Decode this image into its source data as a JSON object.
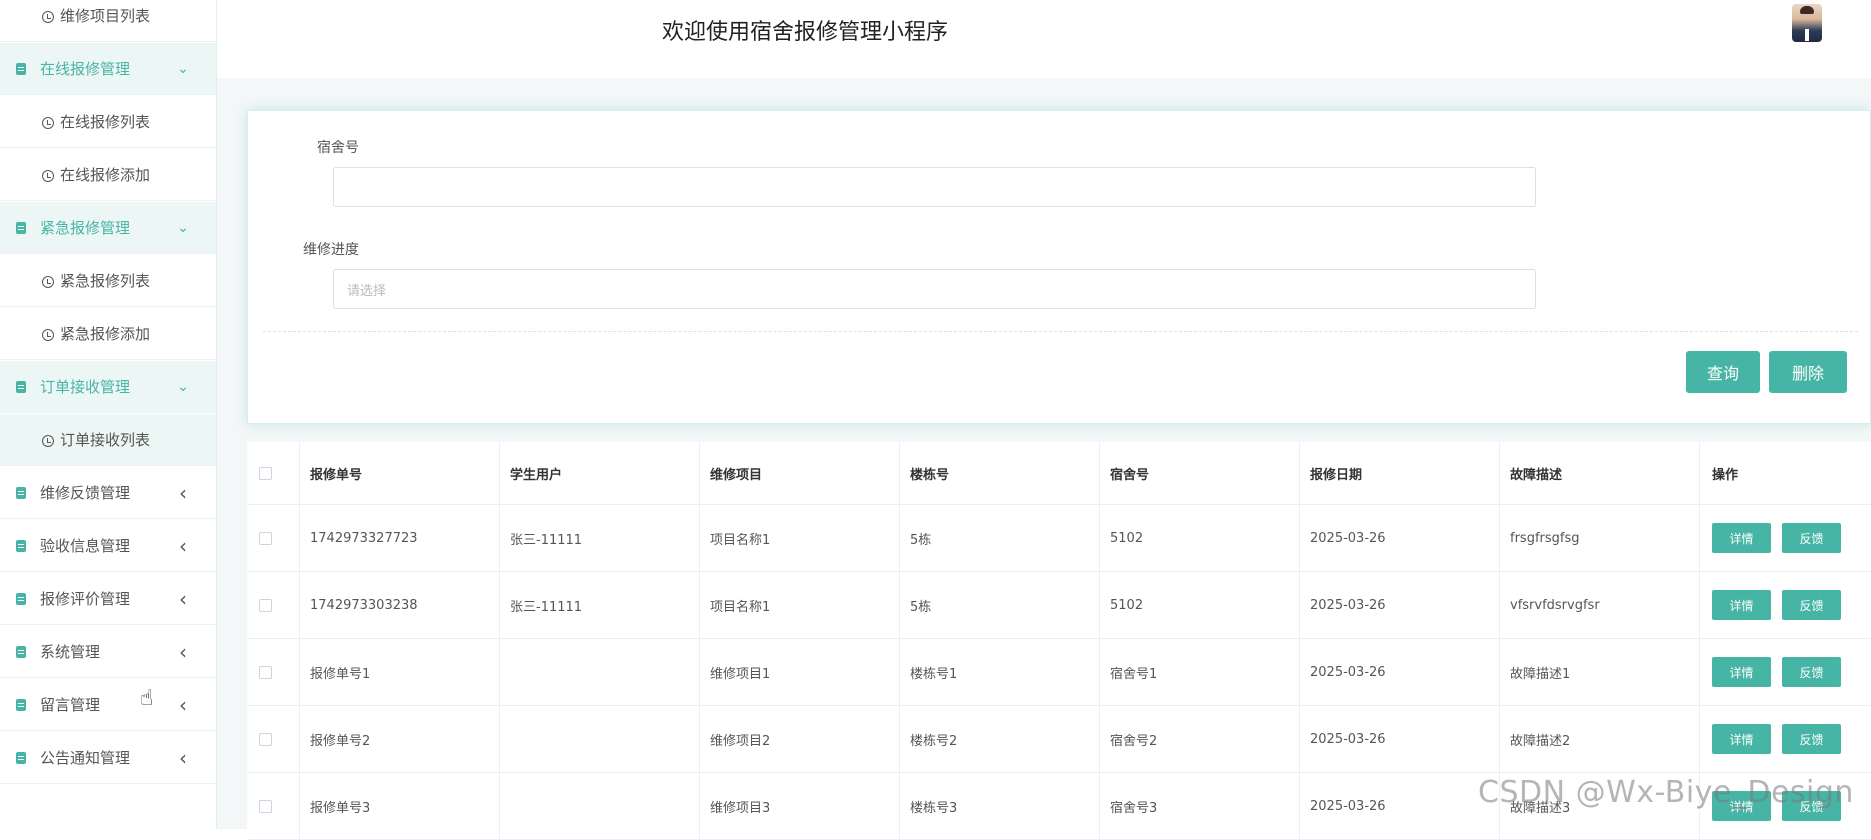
{
  "app": {
    "title": "欢迎使用宿舍报修管理小程序"
  },
  "sidebar": {
    "items": [
      {
        "type": "sub",
        "label": "维修项目列表"
      },
      {
        "type": "group",
        "label": "在线报修管理",
        "arrow": "expanded"
      },
      {
        "type": "sub",
        "label": "在线报修列表"
      },
      {
        "type": "sub",
        "label": "在线报修添加"
      },
      {
        "type": "group",
        "label": "紧急报修管理",
        "arrow": "expanded"
      },
      {
        "type": "sub",
        "label": "紧急报修列表"
      },
      {
        "type": "sub",
        "label": "紧急报修添加"
      },
      {
        "type": "group",
        "label": "订单接收管理",
        "arrow": "expanded"
      },
      {
        "type": "sub",
        "label": "订单接收列表",
        "active": true
      },
      {
        "type": "group-plain",
        "label": "维修反馈管理",
        "arrow": "collapsed"
      },
      {
        "type": "group-plain",
        "label": "验收信息管理",
        "arrow": "collapsed"
      },
      {
        "type": "group-plain",
        "label": "报修评价管理",
        "arrow": "collapsed"
      },
      {
        "type": "group-plain",
        "label": "系统管理",
        "arrow": "collapsed"
      },
      {
        "type": "group-plain",
        "label": "留言管理",
        "arrow": "collapsed"
      },
      {
        "type": "group-plain",
        "label": "公告通知管理",
        "arrow": "collapsed"
      }
    ]
  },
  "search": {
    "dorm_label": "宿舍号",
    "dorm_value": "",
    "progress_label": "维修进度",
    "progress_placeholder": "请选择",
    "query_button": "查询",
    "delete_button": "删除"
  },
  "table": {
    "headers": [
      "报修单号",
      "学生用户",
      "维修项目",
      "楼栋号",
      "宿舍号",
      "报修日期",
      "故障描述",
      "操作"
    ],
    "rows": [
      [
        "1742973327723",
        "张三-11111",
        "项目名称1",
        "5栋",
        "5102",
        "2025-03-26",
        "frsgfrsgfsg"
      ],
      [
        "1742973303238",
        "张三-11111",
        "项目名称1",
        "5栋",
        "5102",
        "2025-03-26",
        "vfsrvfdsrvgfsr"
      ],
      [
        "报修单号1",
        "",
        "维修项目1",
        "楼栋号1",
        "宿舍号1",
        "2025-03-26",
        "故障描述1"
      ],
      [
        "报修单号2",
        "",
        "维修项目2",
        "楼栋号2",
        "宿舍号2",
        "2025-03-26",
        "故障描述2"
      ],
      [
        "报修单号3",
        "",
        "维修项目3",
        "楼栋号3",
        "宿舍号3",
        "2025-03-26",
        "故障描述3"
      ]
    ],
    "detail_button": "详情",
    "feedback_button": "反馈"
  },
  "watermark": "CSDN @Wx-Biye_Design",
  "colors": {
    "accent": "#47b5a5",
    "group_bg": "#ecf6f4"
  }
}
